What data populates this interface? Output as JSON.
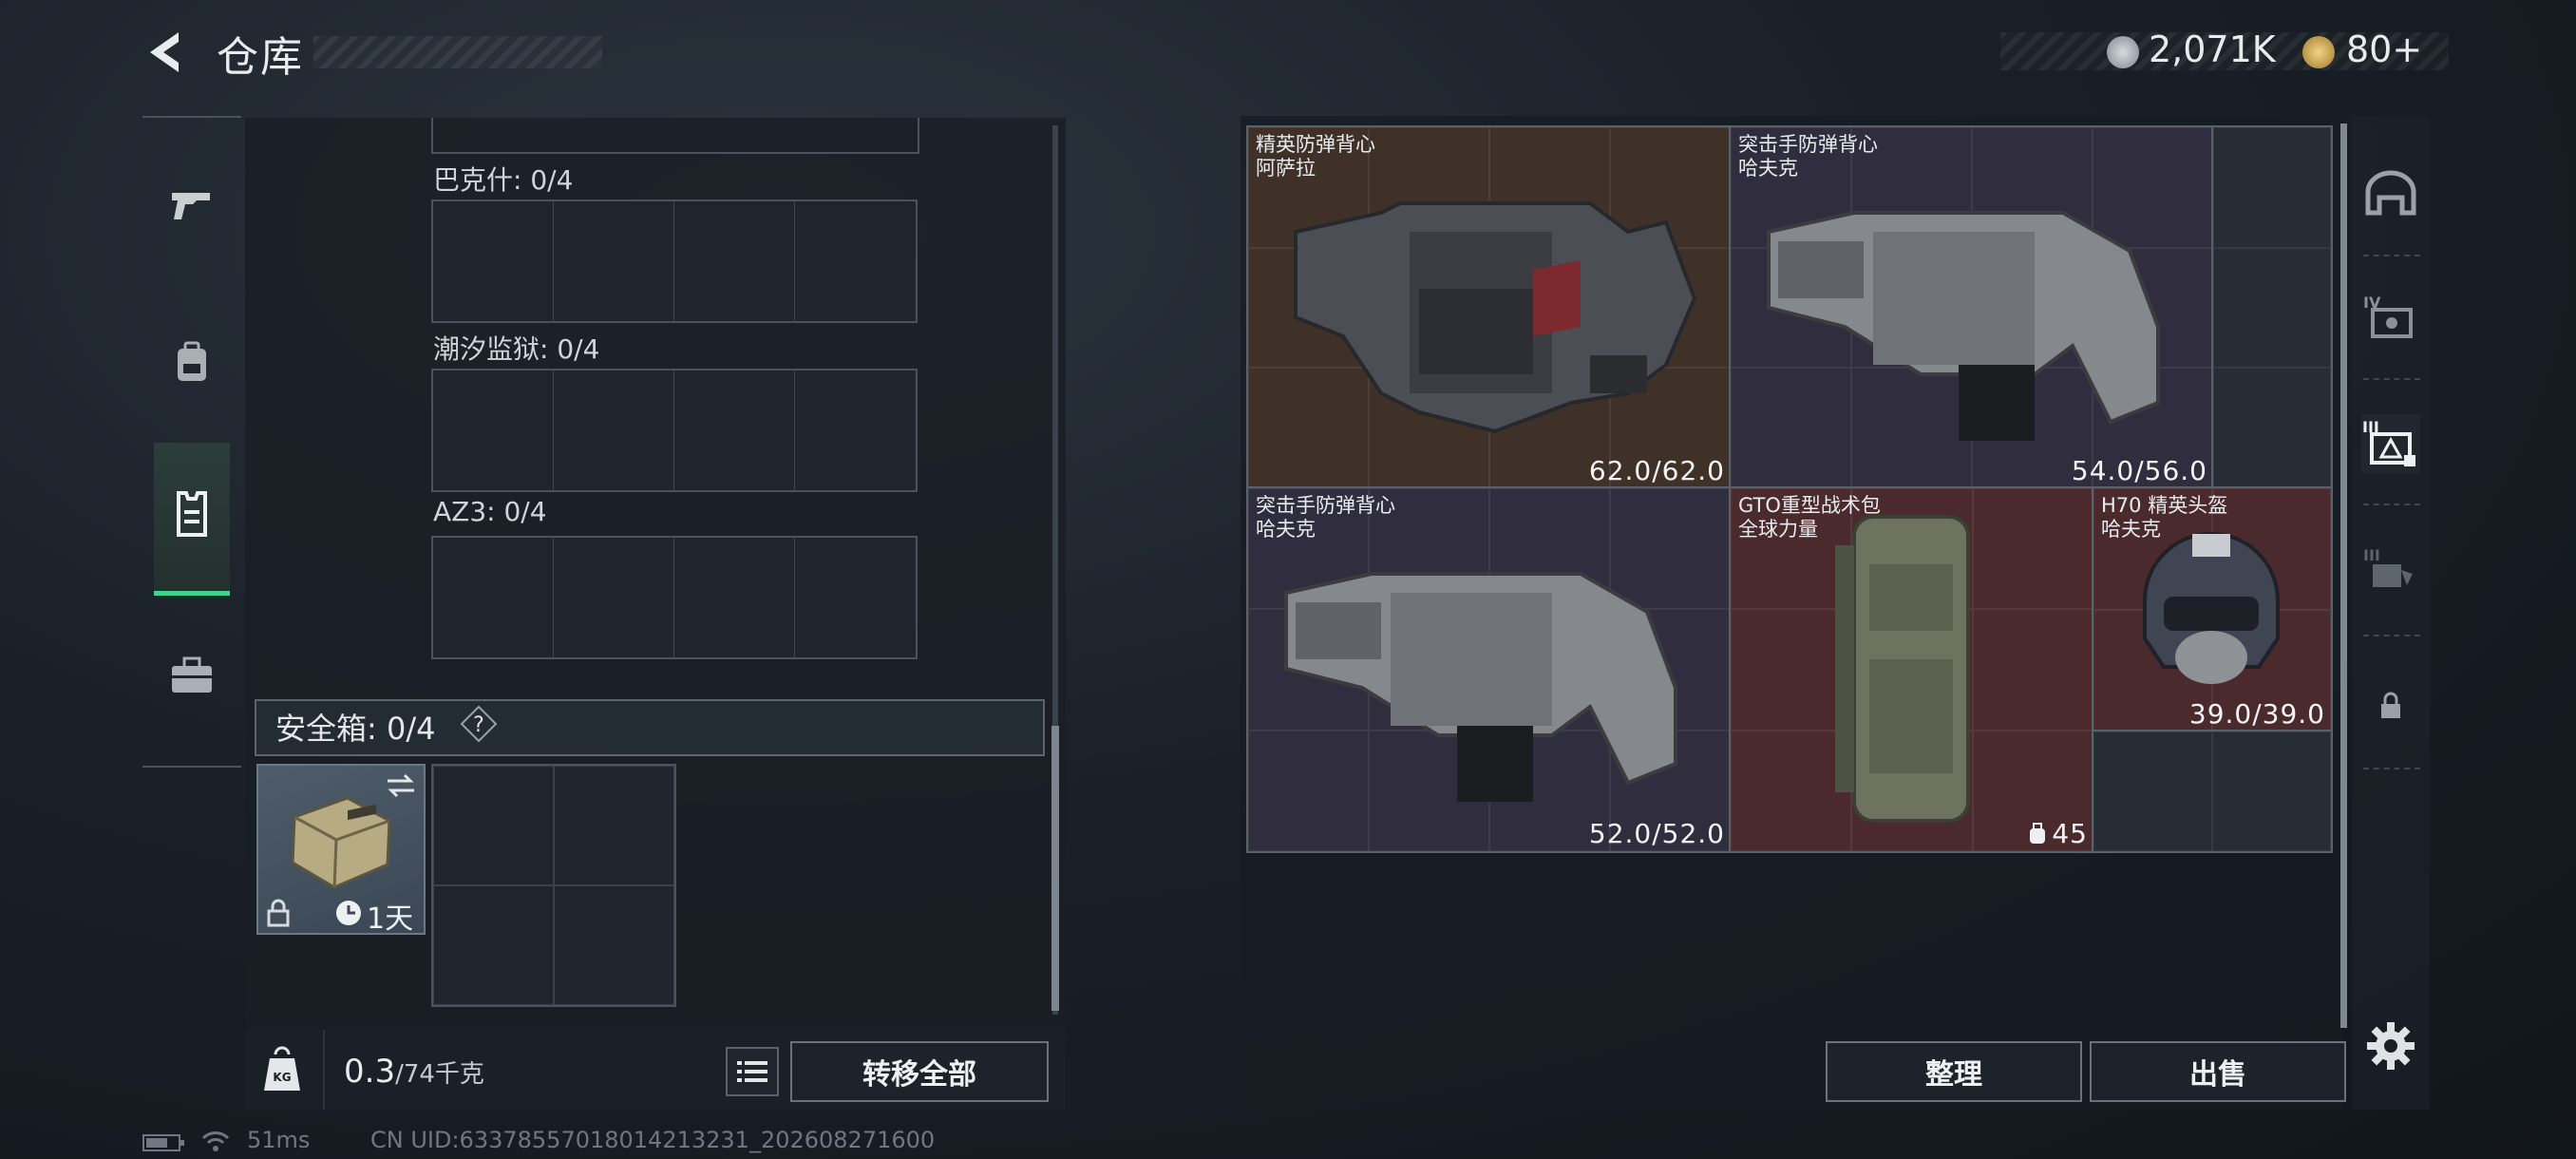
{
  "header": {
    "title": "仓库",
    "currency_silver": "2,071K",
    "currency_gold": "80+"
  },
  "left_rail": {
    "items": [
      "gun-icon",
      "backpack-icon",
      "vest-icon",
      "briefcase-icon"
    ],
    "active": "vest-icon"
  },
  "left_panel": {
    "sections": [
      {
        "label": "巴克什: 0/4"
      },
      {
        "label": "潮汐监狱: 0/4"
      },
      {
        "label": "AZ3: 0/4"
      }
    ],
    "safe_box": {
      "label": "安全箱: 0/4",
      "help": "?",
      "item_timer": "1天"
    },
    "weight": {
      "current": "0.3",
      "max": "/74千克"
    },
    "transfer_all": "转移全部"
  },
  "right_panel": {
    "items": [
      {
        "name_line1": "精英防弹背心",
        "name_line2": "阿萨拉",
        "value": "62.0/62.0"
      },
      {
        "name_line1": "突击手防弹背心",
        "name_line2": "哈夫克",
        "value": "54.0/56.0"
      },
      {
        "name_line1": "突击手防弹背心",
        "name_line2": "哈夫克",
        "value": "52.0/52.0"
      },
      {
        "name_line1": "GTO重型战术包",
        "name_line2": "全球力量",
        "value": "45"
      },
      {
        "name_line1": "H70 精英头盔",
        "name_line2": "哈夫克",
        "value": "39.0/39.0"
      }
    ],
    "sort_button": "整理",
    "sell_button": "出售"
  },
  "status_bar": {
    "ping": "51ms",
    "uid": "CN UID:6337855701801421323​1_202608271600"
  },
  "colors": {
    "accent_green": "#3fd28e",
    "rarity_orange_bg": "#3f3128",
    "rarity_purple_bg": "#302d3e",
    "rarity_red_bg": "#4a2a2c"
  }
}
